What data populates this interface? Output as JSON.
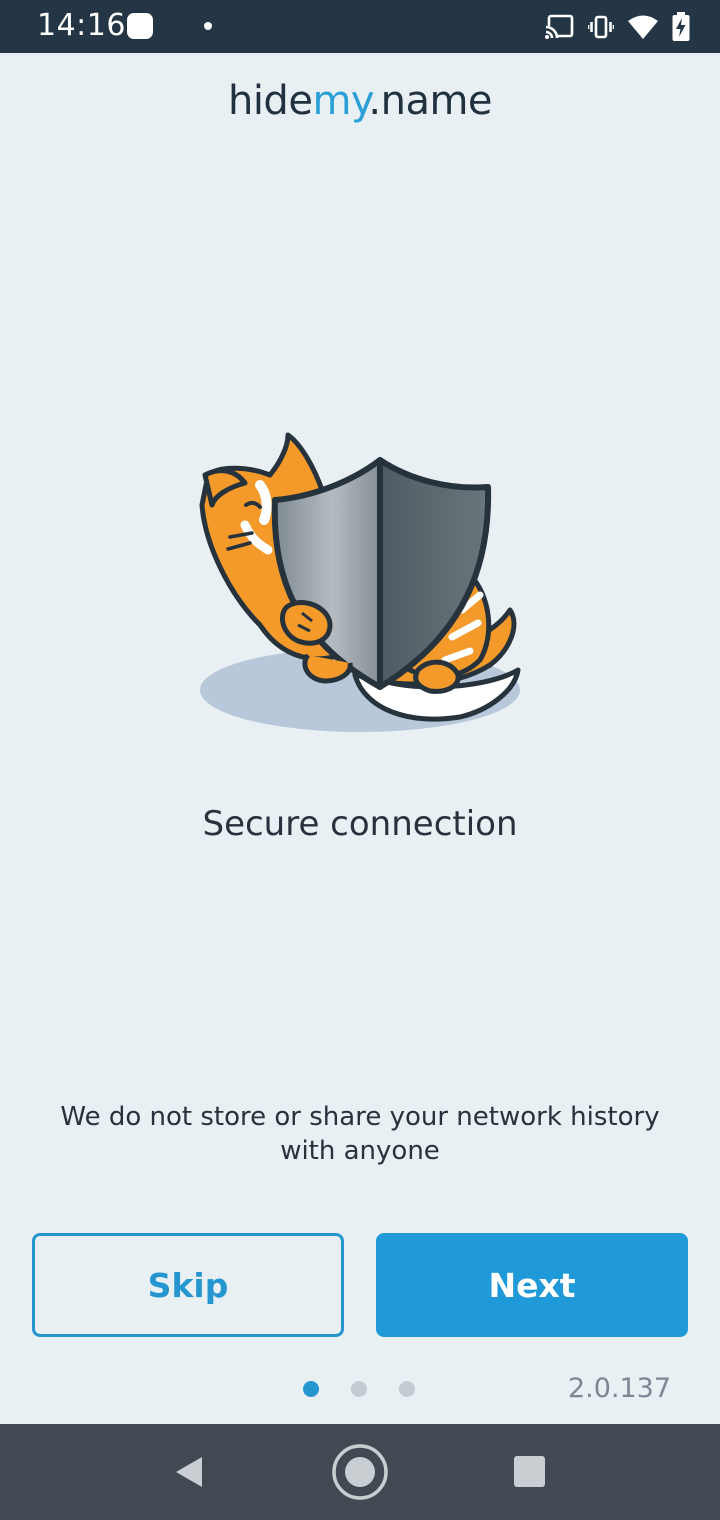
{
  "status_bar": {
    "time": "14:16",
    "icons": [
      "app-notification-icon",
      "notification-dot-icon",
      "cast-icon",
      "vibrate-icon",
      "wifi-icon",
      "battery-charging-icon"
    ]
  },
  "brand": {
    "part1": "hide",
    "part2": "my",
    "part3": ".name"
  },
  "illustration": {
    "subject": "cat-with-shield-icon"
  },
  "onboarding": {
    "headline": "Secure connection",
    "description": "We do not store or share your network history with anyone"
  },
  "actions": {
    "skip_label": "Skip",
    "next_label": "Next"
  },
  "pager": {
    "total": 3,
    "active_index": 0
  },
  "version": "2.0.137",
  "nav_bar": {
    "icons": [
      "back-icon",
      "home-icon",
      "recents-icon"
    ]
  },
  "colors": {
    "background": "#e8f0f4",
    "accent": "#2099d8",
    "status_bar": "#243645",
    "nav_bar": "#414a52",
    "text": "#27323d"
  }
}
